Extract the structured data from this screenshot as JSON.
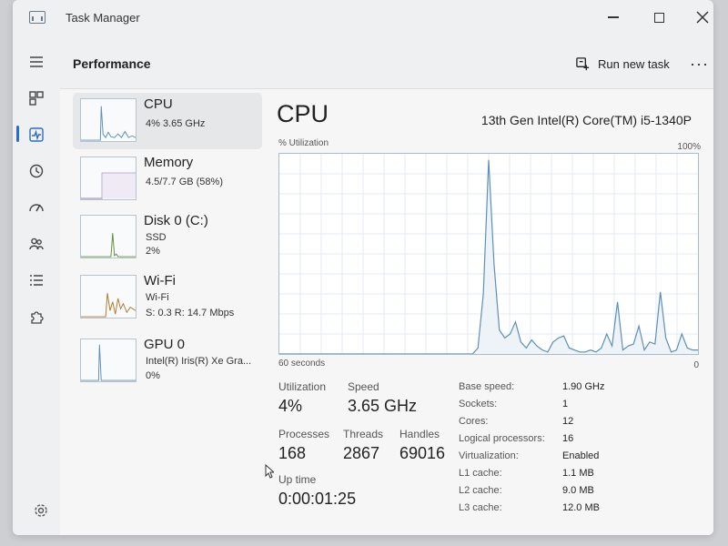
{
  "window": {
    "title": "Task Manager",
    "icon": "task-manager-icon"
  },
  "nav": {
    "items": [
      {
        "name": "hamburger-menu-icon",
        "icon": "menu"
      },
      {
        "name": "processes-icon",
        "icon": "grid"
      },
      {
        "name": "performance-icon",
        "icon": "pulse",
        "active": true
      },
      {
        "name": "app-history-icon",
        "icon": "history"
      },
      {
        "name": "startup-apps-icon",
        "icon": "speedometer"
      },
      {
        "name": "users-icon",
        "icon": "users"
      },
      {
        "name": "details-icon",
        "icon": "list"
      },
      {
        "name": "services-icon",
        "icon": "puzzle"
      }
    ],
    "settings_icon": "gear-icon"
  },
  "header": {
    "title": "Performance",
    "run_task_label": "Run new task",
    "more_label": "···"
  },
  "resources": [
    {
      "name": "CPU",
      "lines": [
        "4% 3.65 GHz"
      ],
      "active": true
    },
    {
      "name": "Memory",
      "lines": [
        "4.5/7.7 GB (58%)"
      ]
    },
    {
      "name": "Disk 0 (C:)",
      "lines": [
        "SSD",
        "2%"
      ]
    },
    {
      "name": "Wi-Fi",
      "lines": [
        "Wi-Fi",
        "S: 0.3 R: 14.7 Mbps"
      ]
    },
    {
      "name": "GPU 0",
      "lines": [
        "Intel(R) Iris(R) Xe Gra...",
        "0%"
      ]
    }
  ],
  "detail": {
    "title": "CPU",
    "model": "13th Gen Intel(R) Core(TM) i5-1340P",
    "graph_label": "% Utilization",
    "graph_max": "100%",
    "graph_time": "60 seconds",
    "graph_min": "0",
    "graph_color": "#5d8fb8",
    "utilization_samples": [
      0,
      0,
      0,
      0,
      0,
      0,
      0,
      0,
      0,
      0,
      0,
      0,
      0,
      0,
      0,
      0,
      0,
      0,
      0,
      0,
      0,
      0,
      0,
      0,
      0,
      0,
      0,
      0,
      0,
      0,
      0,
      0,
      0,
      0,
      0,
      0,
      0,
      3,
      30,
      97,
      45,
      12,
      8,
      10,
      16,
      6,
      3,
      7,
      4,
      2,
      1,
      6,
      8,
      9,
      3,
      2,
      1,
      1,
      2,
      1,
      3,
      10,
      4,
      26,
      2,
      4,
      5,
      14,
      2,
      6,
      5,
      31,
      8,
      1,
      2,
      10,
      3,
      2,
      2
    ],
    "stats": {
      "utilization_label": "Utilization",
      "utilization_value": "4%",
      "speed_label": "Speed",
      "speed_value": "3.65 GHz",
      "processes_label": "Processes",
      "processes_value": "168",
      "threads_label": "Threads",
      "threads_value": "2867",
      "handles_label": "Handles",
      "handles_value": "69016",
      "uptime_label": "Up time",
      "uptime_value": "0:00:01:25"
    },
    "specs": [
      {
        "label": "Base speed:",
        "value": "1.90 GHz"
      },
      {
        "label": "Sockets:",
        "value": "1"
      },
      {
        "label": "Cores:",
        "value": "12"
      },
      {
        "label": "Logical processors:",
        "value": "16"
      },
      {
        "label": "Virtualization:",
        "value": "Enabled"
      },
      {
        "label": "L1 cache:",
        "value": "1.1 MB"
      },
      {
        "label": "L2 cache:",
        "value": "9.0 MB"
      },
      {
        "label": "L3 cache:",
        "value": "12.0 MB"
      }
    ]
  }
}
